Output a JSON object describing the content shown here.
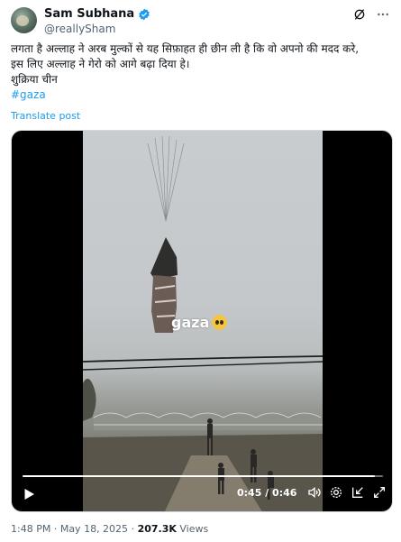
{
  "author": {
    "display_name": "Sam Subhana",
    "handle": "@reallySham"
  },
  "post": {
    "line1": "लगता है अल्लाह ने अरब मुल्कों से यह सिफ़ाहत ही छीन ली है कि वो अपनो की मदद करे,",
    "line2": "इस लिए अल्लाह ने गेरो को आगे बढ़ा दिया हे।",
    "line3": "शुक्रिया चीन",
    "hashtag": "#gaza",
    "translate_label": "Translate post"
  },
  "video": {
    "watermark_text": "gaza",
    "time_display": "0:45 / 0:46",
    "progress_fraction": 0.978
  },
  "meta": {
    "time": "1:48 PM",
    "date": "May 18, 2025",
    "views_count": "207.3K",
    "views_label": "Views"
  },
  "colors": {
    "accent": "#1d9bf0",
    "text": "#0f1419",
    "muted": "#536471"
  },
  "icons": [
    "verified-badge-icon",
    "grok-icon",
    "more-icon",
    "play-icon",
    "volume-icon",
    "settings-icon",
    "pip-icon",
    "fullscreen-icon"
  ]
}
